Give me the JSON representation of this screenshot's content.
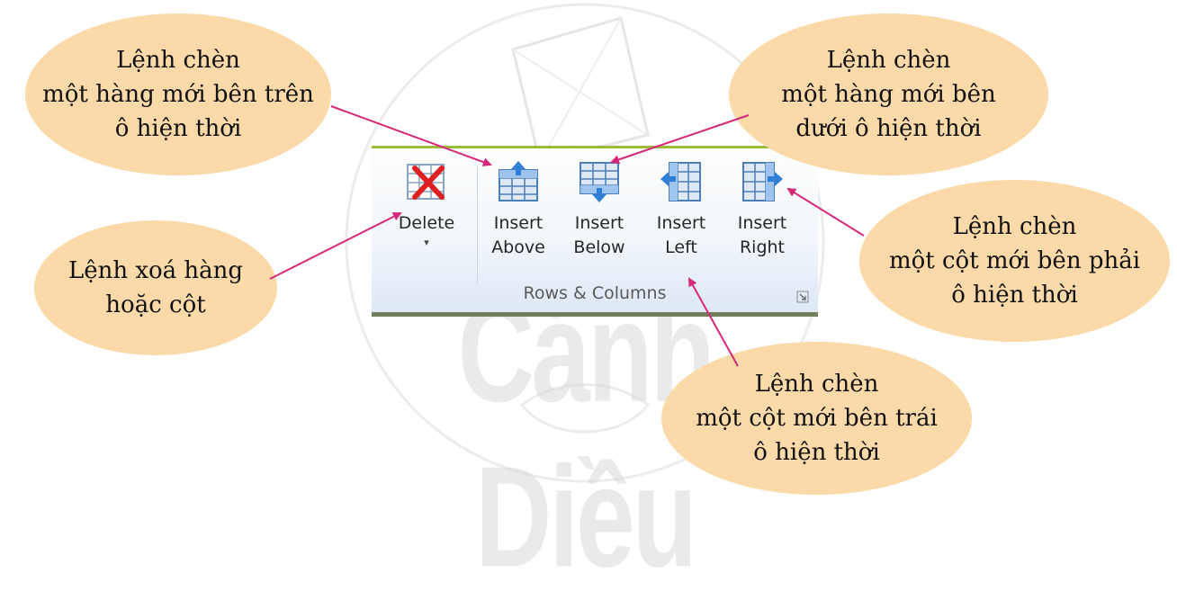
{
  "watermark": {
    "text": "Cánh Diều"
  },
  "ribbon": {
    "group_label": "Rows & Columns",
    "buttons": {
      "delete": {
        "label": "Delete",
        "caret": "▾"
      },
      "insert_above": {
        "line1": "Insert",
        "line2": "Above"
      },
      "insert_below": {
        "line1": "Insert",
        "line2": "Below"
      },
      "insert_left": {
        "line1": "Insert",
        "line2": "Left"
      },
      "insert_right": {
        "line1": "Insert",
        "line2": "Right"
      }
    }
  },
  "callouts": {
    "insert_above": [
      "Lệnh chèn",
      "một hàng mới bên trên",
      "ô hiện thời"
    ],
    "insert_below": [
      "Lệnh chèn",
      "một hàng mới bên",
      "dưới ô hiện thời"
    ],
    "delete": [
      "Lệnh xoá hàng",
      "hoặc cột"
    ],
    "insert_right": [
      "Lệnh chèn",
      "một cột mới bên phải",
      "ô hiện thời"
    ],
    "insert_left": [
      "Lệnh chèn",
      "một cột mới bên trái",
      "ô hiện thời"
    ]
  },
  "colors": {
    "callout_fill": "#fbd9a8",
    "arrow": "#d6287a",
    "ribbon_accent": "#9bbb3a",
    "delete_x": "#e02020",
    "insert_arrow": "#2f7fd6"
  }
}
